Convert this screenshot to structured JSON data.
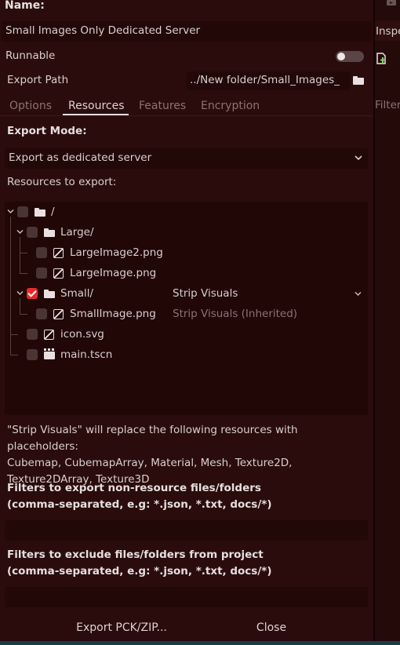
{
  "name_label": "Name:",
  "preset_name": "Small Images Only Dedicated Server",
  "runnable_label": "Runnable",
  "runnable_on": false,
  "export_path_label": "Export Path",
  "export_path_value": "../New folder/Small_Images_",
  "tabs": [
    {
      "label": "Options",
      "active": false
    },
    {
      "label": "Resources",
      "active": true
    },
    {
      "label": "Features",
      "active": false
    },
    {
      "label": "Encryption",
      "active": false
    }
  ],
  "export_mode_label": "Export Mode:",
  "export_mode_value": "Export as dedicated server",
  "resources_label": "Resources to export:",
  "tree": [
    {
      "name": "/",
      "icon": "folder-icon",
      "checked": false,
      "mode": ""
    },
    {
      "name": "Large/",
      "icon": "folder-icon",
      "checked": false,
      "mode": ""
    },
    {
      "name": "LargeImage2.png",
      "icon": "image-icon",
      "checked": false,
      "mode": ""
    },
    {
      "name": "LargeImage.png",
      "icon": "image-icon",
      "checked": false,
      "mode": ""
    },
    {
      "name": "Small/",
      "icon": "folder-icon",
      "checked": true,
      "mode": "Strip Visuals"
    },
    {
      "name": "SmallImage.png",
      "icon": "image-icon",
      "checked": false,
      "mode": "Strip Visuals (Inherited)"
    },
    {
      "name": "icon.svg",
      "icon": "image-icon",
      "checked": false,
      "mode": ""
    },
    {
      "name": "main.tscn",
      "icon": "scene-icon",
      "checked": false,
      "mode": ""
    }
  ],
  "strip_note": [
    "\"Strip Visuals\" will replace the following resources with placeholders:",
    "Cubemap, CubemapArray, Material, Mesh, Texture2D,",
    "Texture2DArray, Texture3D"
  ],
  "include_filters_label": [
    "Filters to export non-resource files/folders",
    "(comma-separated, e.g: *.json, *.txt, docs/*)"
  ],
  "include_filters_value": "",
  "exclude_filters_label": [
    "Filters to exclude files/folders from project",
    "(comma-separated, e.g: *.json, *.txt, docs/*)"
  ],
  "exclude_filters_value": "",
  "buttons": {
    "export_pck": "Export PCK/ZIP...",
    "close": "Close"
  },
  "right_pane": {
    "tab": "Inspe",
    "filter": "Filter"
  },
  "colors": {
    "panel_bg": "#2b0c0c",
    "field_bg": "#230808",
    "checkbox_checked": "#e62a2a",
    "accent_text": "#e6dede"
  }
}
